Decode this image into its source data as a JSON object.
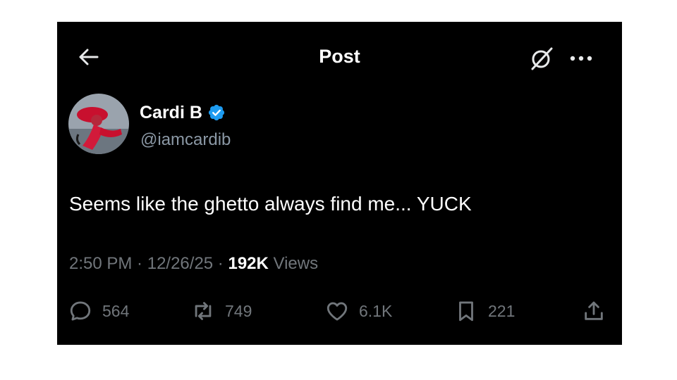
{
  "header": {
    "title": "Post",
    "back_icon": "arrow-left-icon",
    "grok_icon": "grok-slash-icon",
    "more_icon": "ellipsis-icon"
  },
  "author": {
    "display_name": "Cardi B",
    "handle": "@iamcardib",
    "verified_icon": "verified-badge-icon",
    "verified_color": "#1d9bf0"
  },
  "post": {
    "text": "Seems like the ghetto always find me... YUCK"
  },
  "meta": {
    "time": "2:50 PM",
    "separator": " · ",
    "date": "12/26/25",
    "views_count": "192K",
    "views_label": "Views"
  },
  "actions": {
    "replies": {
      "icon": "reply-icon",
      "count": "564"
    },
    "reposts": {
      "icon": "repost-icon",
      "count": "749"
    },
    "likes": {
      "icon": "heart-icon",
      "count": "6.1K"
    },
    "bookmarks": {
      "icon": "bookmark-icon",
      "count": "221"
    },
    "share": {
      "icon": "share-icon"
    }
  },
  "colors": {
    "background": "#000000",
    "text_primary": "#ffffff",
    "text_secondary": "#71767b",
    "accent": "#1d9bf0"
  }
}
